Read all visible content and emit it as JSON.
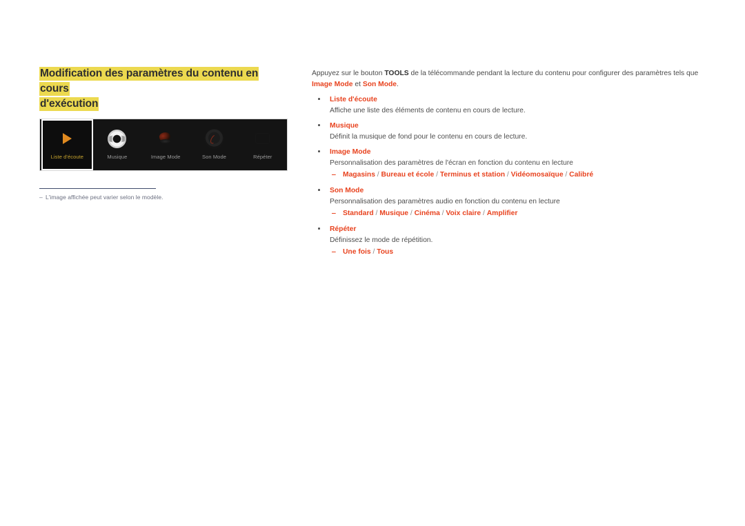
{
  "heading": {
    "line1": "Modification des paramètres du contenu en cours",
    "line2": "d'exécution",
    "highlight_color": "#ecd94f"
  },
  "device_panel": {
    "background": "#141414",
    "tiles": [
      {
        "label": "Liste d'écoute",
        "icon": "play-triangle-icon",
        "selected": true
      },
      {
        "label": "Musique",
        "icon": "music-disc-icon",
        "selected": false
      },
      {
        "label": "Image Mode",
        "icon": "image-mode-icon",
        "selected": false
      },
      {
        "label": "Son Mode",
        "icon": "sound-mode-dial-icon",
        "selected": false
      },
      {
        "label": "Répéter",
        "icon": "repeat-icon",
        "selected": false
      }
    ]
  },
  "footnote": {
    "dash": "‒",
    "text": "L'image affichée peut varier selon le modèle."
  },
  "content": {
    "intro": {
      "part1": "Appuyez sur le bouton ",
      "bold1": "TOOLS",
      "part2": " de la télécommande pendant la lecture du contenu pour configurer des paramètres tels que ",
      "accent1": "Image Mode",
      "part3": " et ",
      "accent2": "Son Mode",
      "part4": "."
    },
    "items": [
      {
        "title": "Liste d'écoute",
        "desc": "Affiche une liste des éléments de contenu en cours de lecture.",
        "options": null
      },
      {
        "title": "Musique",
        "desc": "Définit la musique de fond pour le contenu en cours de lecture.",
        "options": null
      },
      {
        "title": "Image Mode",
        "desc": "Personnalisation des paramètres de l'écran en fonction du contenu en lecture",
        "options": [
          "Magasins",
          "Bureau et école",
          "Terminus et station",
          "Vidéomosaïque",
          "Calibré"
        ]
      },
      {
        "title": "Son Mode",
        "desc": "Personnalisation des paramètres audio en fonction du contenu en lecture",
        "options": [
          "Standard",
          "Musique",
          "Cinéma",
          "Voix claire",
          "Amplifier"
        ]
      },
      {
        "title": "Répéter",
        "desc": "Définissez le mode de répétition.",
        "options": [
          "Une fois",
          "Tous"
        ]
      }
    ],
    "accent_color": "#e8431f",
    "sub_dash": "‒",
    "option_separator": "/"
  }
}
